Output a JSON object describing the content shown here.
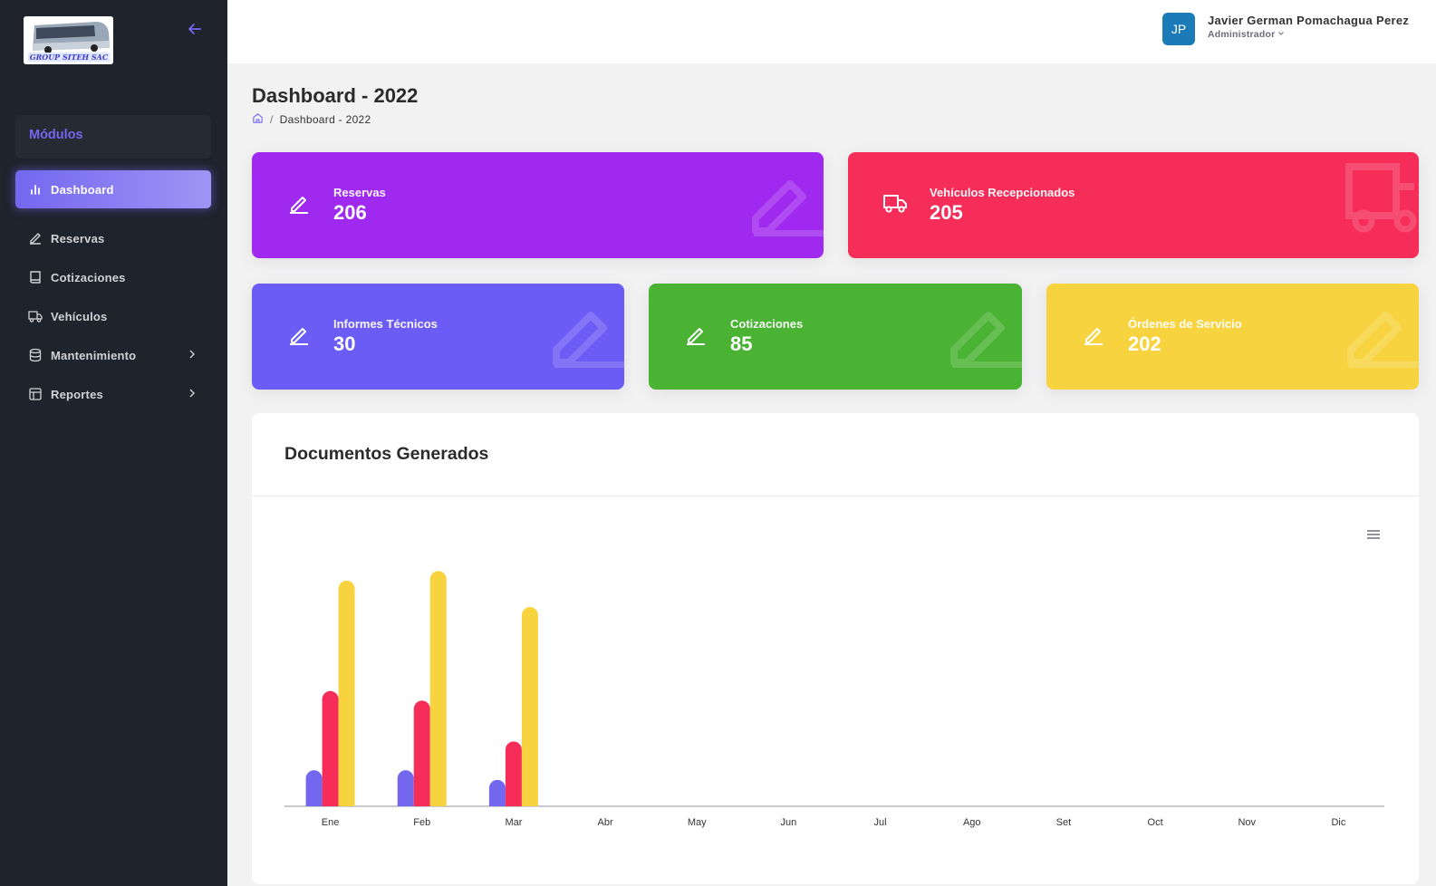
{
  "app": {
    "logo_text": "GROUP SITEH SAC",
    "accent": "#7367f0"
  },
  "sidebar": {
    "modules_label": "Módulos",
    "items": [
      {
        "label": "Dashboard",
        "icon": "bar-chart-icon",
        "active": true
      },
      {
        "label": "Reservas",
        "icon": "edit-icon"
      },
      {
        "label": "Cotizaciones",
        "icon": "book-icon"
      },
      {
        "label": "Vehículos",
        "icon": "truck-icon"
      },
      {
        "label": "Mantenimiento",
        "icon": "database-icon",
        "has_submenu": true
      },
      {
        "label": "Reportes",
        "icon": "layout-icon",
        "has_submenu": true
      }
    ]
  },
  "header": {
    "avatar_initials": "JP",
    "user_name": "Javier German Pomachagua Perez",
    "user_role": "Administrador"
  },
  "page": {
    "title": "Dashboard - 2022",
    "breadcrumb": "Dashboard - 2022"
  },
  "stats": [
    {
      "label": "Reservas",
      "value": "206",
      "color": "#a029ef",
      "icon": "edit-icon"
    },
    {
      "label": "Vehículos Recepcionados",
      "value": "205",
      "color": "#f52d58",
      "icon": "truck-icon"
    },
    {
      "label": "Informes Técnicos",
      "value": "30",
      "color": "#6b5cf5",
      "icon": "edit-icon"
    },
    {
      "label": "Cotizaciones",
      "value": "85",
      "color": "#4ab333",
      "icon": "edit-icon"
    },
    {
      "label": "Órdenes de Servicio",
      "value": "202",
      "color": "#f7d43f",
      "icon": "edit-icon"
    }
  ],
  "chart": {
    "title": "Documentos Generados"
  },
  "chart_data": {
    "type": "bar",
    "categories": [
      "Ene",
      "Feb",
      "Mar",
      "Abr",
      "May",
      "Jun",
      "Jul",
      "Ago",
      "Set",
      "Oct",
      "Nov",
      "Dic"
    ],
    "series": [
      {
        "values": [
          15,
          15,
          11,
          0,
          0,
          0,
          0,
          0,
          0,
          0,
          0,
          0
        ],
        "color": "#7367f0"
      },
      {
        "values": [
          48,
          44,
          27,
          0,
          0,
          0,
          0,
          0,
          0,
          0,
          0,
          0
        ],
        "color": "#f52d58"
      },
      {
        "values": [
          94,
          98,
          83,
          0,
          0,
          0,
          0,
          0,
          0,
          0,
          0,
          0
        ],
        "color": "#f7d43f"
      }
    ],
    "ylim": [
      0,
      100
    ],
    "grid": false,
    "legend": "none"
  }
}
